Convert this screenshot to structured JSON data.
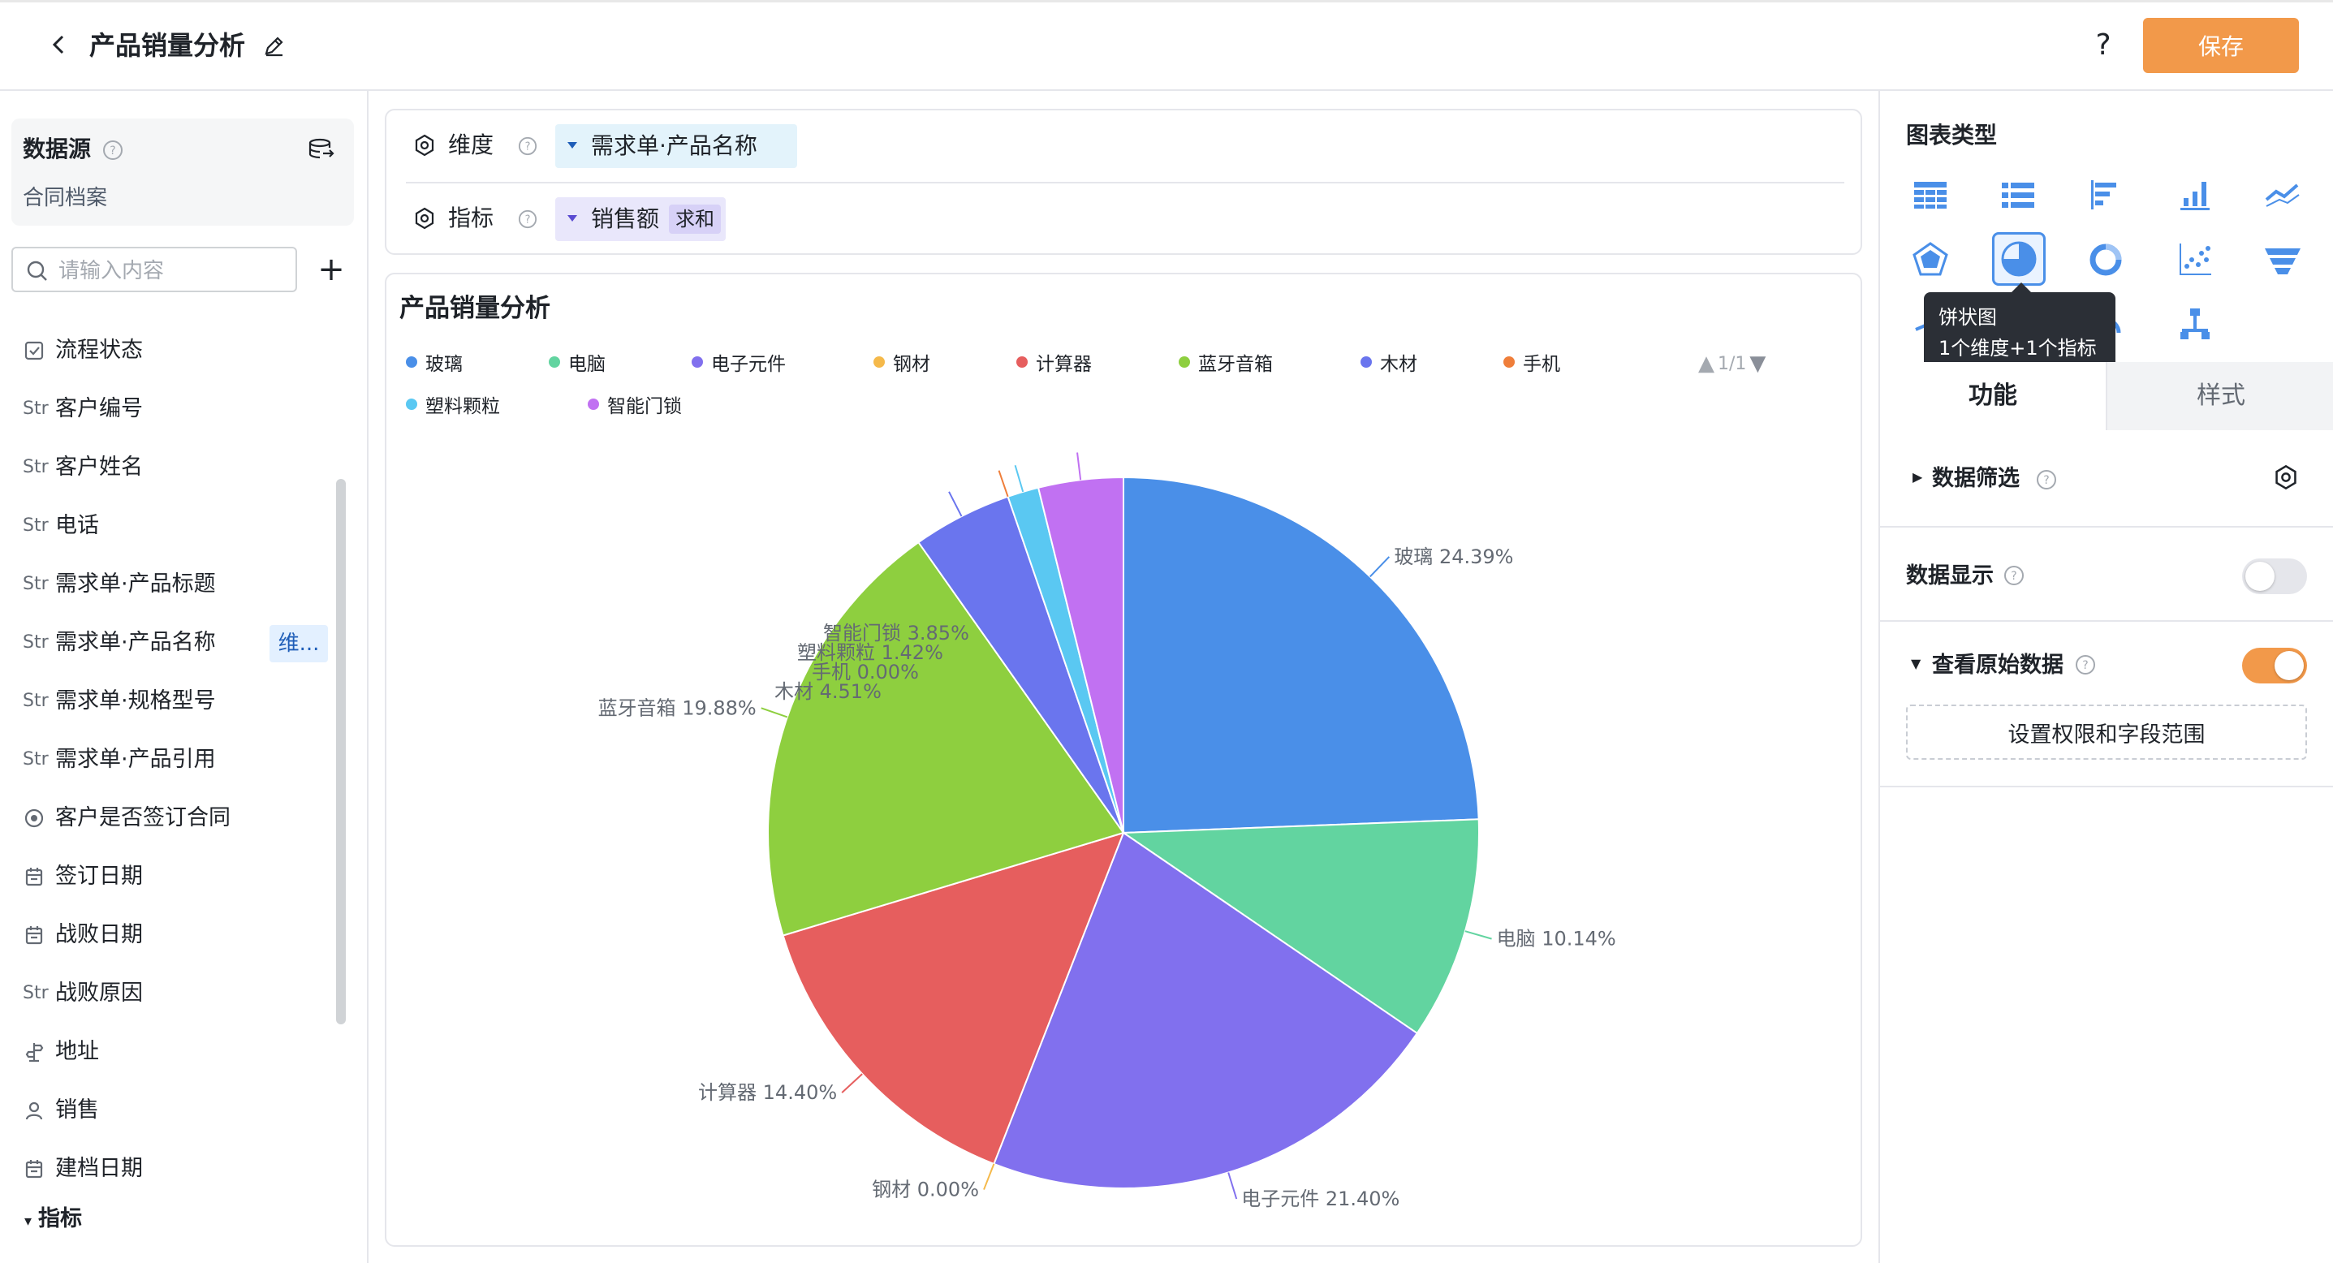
{
  "header": {
    "title": "产品销量分析",
    "help_label": "?",
    "save_label": "保存"
  },
  "sidebar": {
    "datasource_title": "数据源",
    "datasource_name": "合同档案",
    "search_placeholder": "请输入内容",
    "add_label": "+",
    "fields": [
      {
        "type": "check",
        "type_text": "",
        "label": "流程状态"
      },
      {
        "type": "str",
        "type_text": "Str",
        "label": "客户编号"
      },
      {
        "type": "str",
        "type_text": "Str",
        "label": "客户姓名"
      },
      {
        "type": "str",
        "type_text": "Str",
        "label": "电话"
      },
      {
        "type": "str",
        "type_text": "Str",
        "label": "需求单·产品标题"
      },
      {
        "type": "str",
        "type_text": "Str",
        "label": "需求单·产品名称"
      },
      {
        "type": "str",
        "type_text": "Str",
        "label": "需求单·规格型号"
      },
      {
        "type": "str",
        "type_text": "Str",
        "label": "需求单·产品引用"
      },
      {
        "type": "radio",
        "type_text": "",
        "label": "客户是否签订合同"
      },
      {
        "type": "date",
        "type_text": "",
        "label": "签订日期"
      },
      {
        "type": "date",
        "type_text": "",
        "label": "战败日期"
      },
      {
        "type": "str",
        "type_text": "Str",
        "label": "战败原因"
      },
      {
        "type": "address",
        "type_text": "",
        "label": "地址"
      },
      {
        "type": "user",
        "type_text": "",
        "label": "销售"
      },
      {
        "type": "date",
        "type_text": "",
        "label": "建档日期"
      }
    ],
    "dimension_tag": "维...",
    "metrics_section": "指标"
  },
  "config": {
    "dimension_label": "维度",
    "dimension_value": "需求单·产品名称",
    "metric_label": "指标",
    "metric_value": "销售额",
    "metric_agg": "求和"
  },
  "chart_panel": {
    "title": "产品销量分析",
    "legend_pager": "1/1"
  },
  "chart_data": {
    "type": "pie",
    "title": "产品销量分析",
    "slices": [
      {
        "name": "玻璃",
        "percent": 24.39,
        "label": "玻璃 24.39%",
        "color": "#4a8fe8"
      },
      {
        "name": "电脑",
        "percent": 10.14,
        "label": "电脑 10.14%",
        "color": "#62d4a0"
      },
      {
        "name": "电子元件",
        "percent": 21.4,
        "label": "电子元件 21.40%",
        "color": "#8170ee"
      },
      {
        "name": "钢材",
        "percent": 0.0,
        "label": "钢材 0.00%",
        "color": "#f5b94a"
      },
      {
        "name": "计算器",
        "percent": 14.4,
        "label": "计算器 14.40%",
        "color": "#e65e5e"
      },
      {
        "name": "蓝牙音箱",
        "percent": 19.88,
        "label": "蓝牙音箱 19.88%",
        "color": "#8ecf3f"
      },
      {
        "name": "木材",
        "percent": 4.51,
        "label": "木材 4.51%",
        "color": "#6a75ee"
      },
      {
        "name": "手机",
        "percent": 0.0,
        "label": "手机 0.00%",
        "color": "#ef7e3a"
      },
      {
        "name": "塑料颗粒",
        "percent": 1.42,
        "label": "塑料颗粒 1.42%",
        "color": "#5ac8f2"
      },
      {
        "name": "智能门锁",
        "percent": 3.85,
        "label": "智能门锁 3.85%",
        "color": "#c171f2"
      }
    ],
    "legend_placement": "top"
  },
  "right_panel": {
    "chart_type_title": "图表类型",
    "chart_types": [
      "table-icon",
      "list-icon",
      "bar-horizontal-icon",
      "bar-icon",
      "line-icon",
      "radar-icon",
      "pie-icon",
      "donut-icon",
      "scatter-icon",
      "funnel-icon",
      "map-icon",
      "number-card-icon",
      "gauge-icon",
      "tree-icon"
    ],
    "selected_chart_type": "pie-icon",
    "tooltip_title": "饼状图",
    "tooltip_desc": "1个维度+1个指标",
    "tab_function": "功能",
    "tab_style": "样式",
    "filter_label": "数据筛选",
    "data_display_label": "数据显示",
    "data_display_on": false,
    "raw_data_label": "查看原始数据",
    "raw_data_on": true,
    "permission_button": "设置权限和字段范围",
    "accent_color": "#f2994a"
  }
}
